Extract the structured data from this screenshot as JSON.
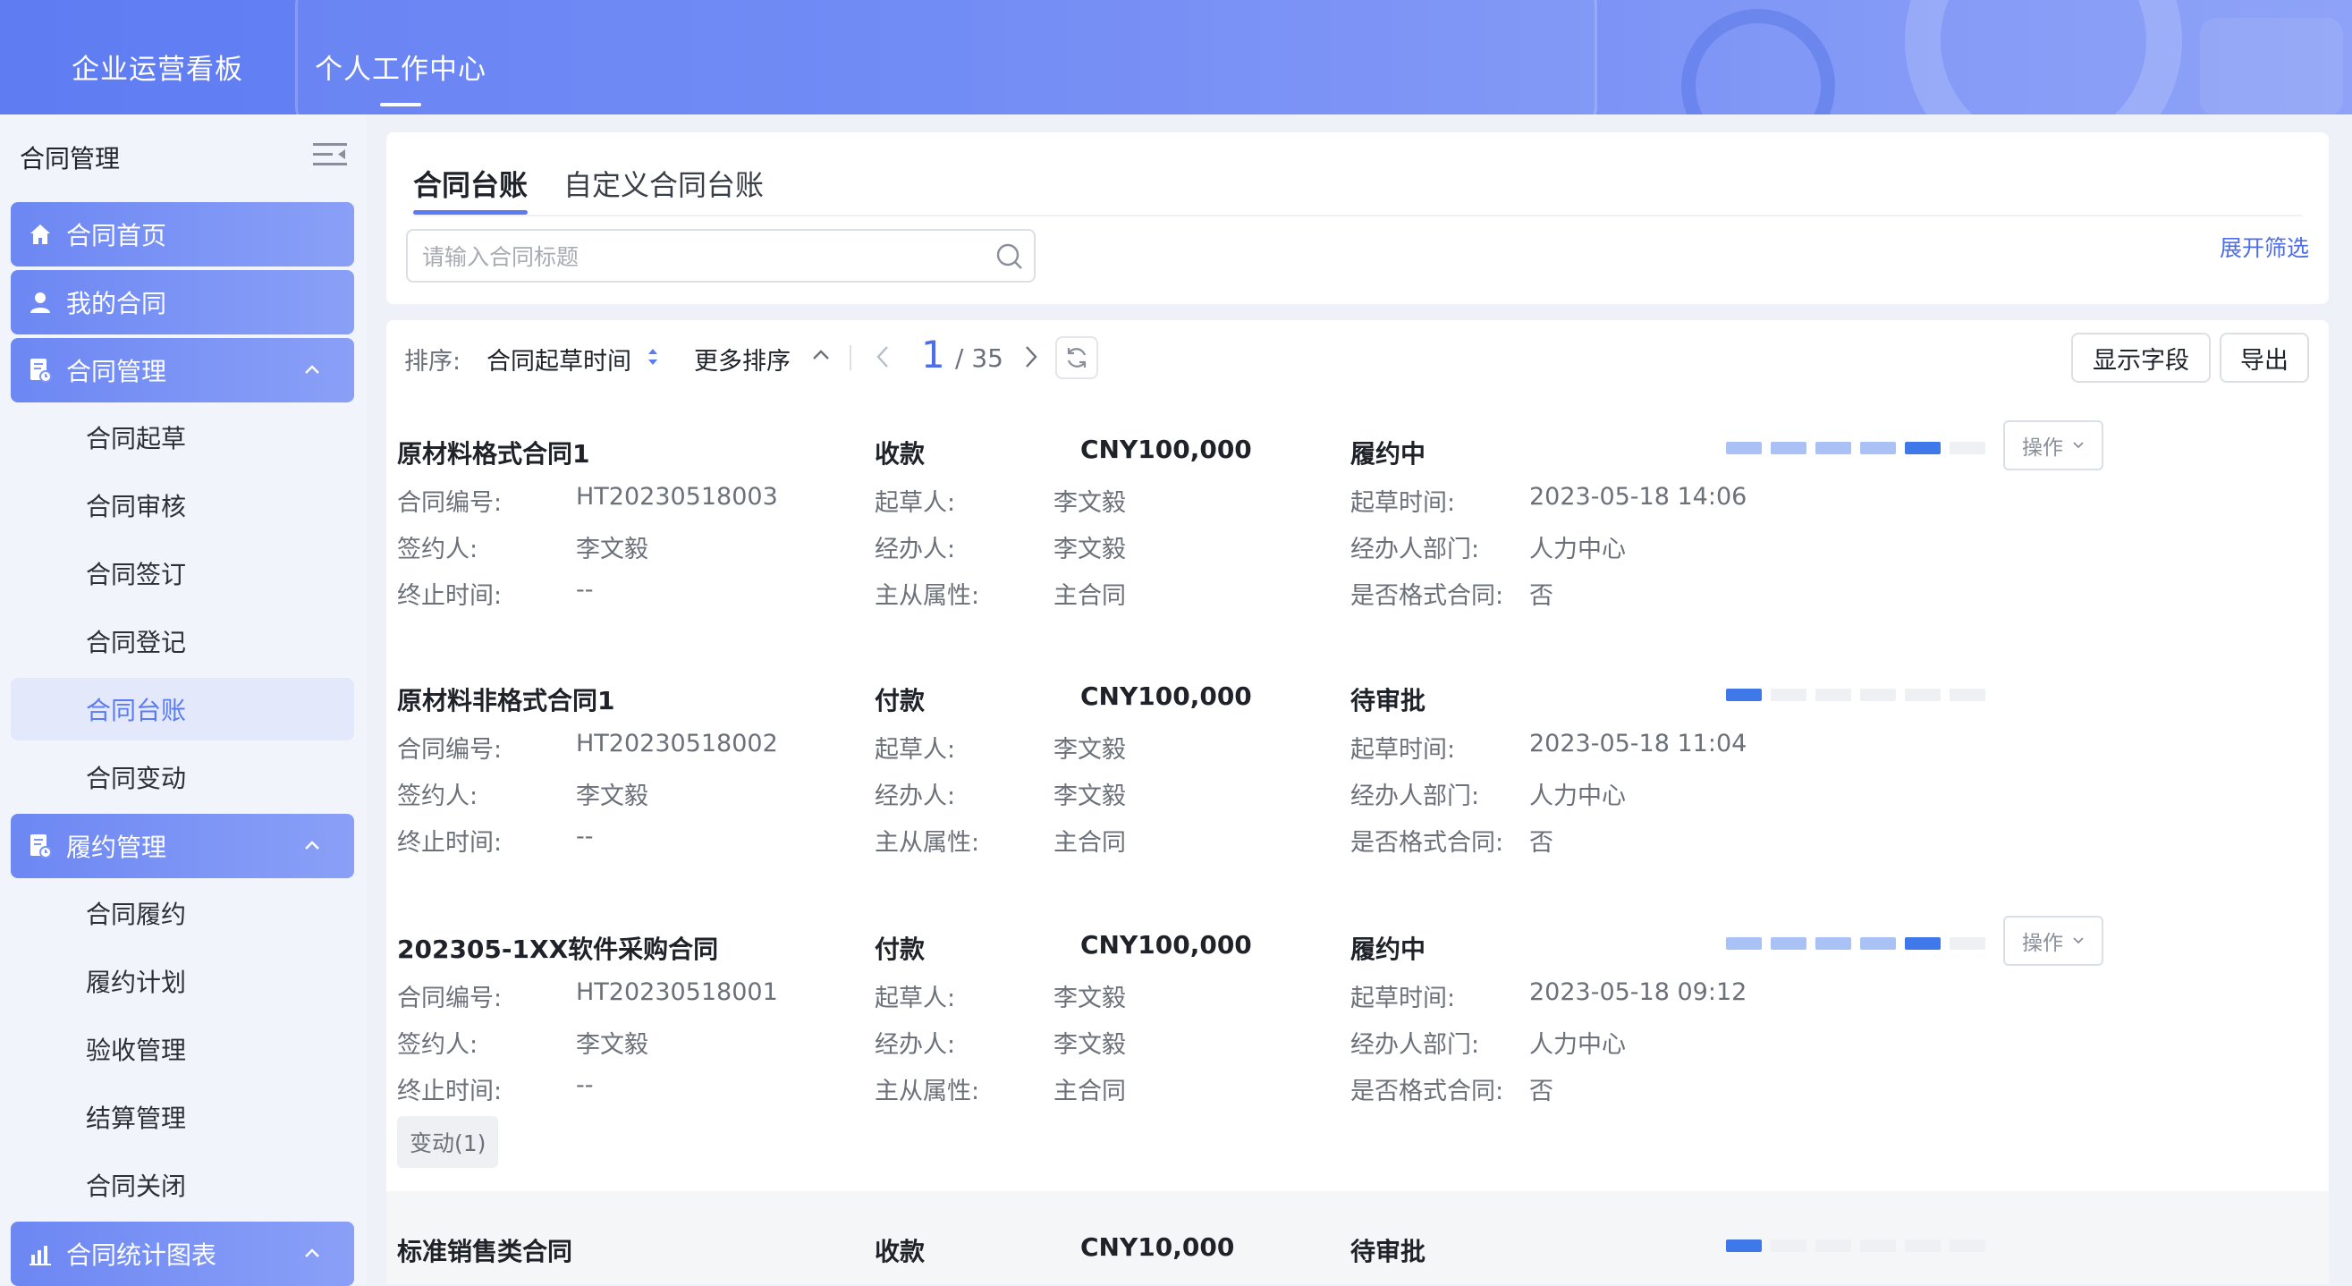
{
  "topnav": {
    "items": [
      "企业运营看板",
      "个人工作中心"
    ],
    "active": 1
  },
  "sidebar": {
    "header": "合同管理",
    "groups": [
      {
        "label": "合同首页",
        "icon": "home-icon"
      },
      {
        "label": "我的合同",
        "icon": "user-icon"
      },
      {
        "label": "合同管理",
        "icon": "contract-icon",
        "expanded": true,
        "children": [
          "合同起草",
          "合同审核",
          "合同签订",
          "合同登记",
          "合同台账",
          "合同变动"
        ],
        "active_child": 4
      },
      {
        "label": "履约管理",
        "icon": "contract-icon",
        "expanded": true,
        "children": [
          "合同履约",
          "履约计划",
          "验收管理",
          "结算管理",
          "合同关闭"
        ]
      },
      {
        "label": "合同统计图表",
        "icon": "chart-icon",
        "expanded": true
      }
    ]
  },
  "tabs": [
    {
      "label": "合同台账",
      "active": true
    },
    {
      "label": "自定义合同台账"
    }
  ],
  "search": {
    "placeholder": "请输入合同标题",
    "value": ""
  },
  "expand_filter": "展开筛选",
  "toolbar": {
    "sort_label": "排序:",
    "sort_field": "合同起草时间",
    "more_sort": "更多排序",
    "page_current": "1",
    "page_total": "/ 35",
    "show_fields": "显示字段",
    "export": "导出"
  },
  "labels": {
    "contract_no": "合同编号:",
    "signer": "签约人:",
    "end_time": "终止时间:",
    "drafter": "起草人:",
    "handler": "经办人:",
    "master_attr": "主从属性:",
    "draft_time": "起草时间:",
    "handler_dept": "经办人部门:",
    "is_format": "是否格式合同:",
    "operate": "操作"
  },
  "colors": {
    "accent": "#5b7cf0",
    "progress_done": "#a9c1f5",
    "progress_current": "#3f78e8",
    "progress_todo": "#eef0f3"
  },
  "rows": [
    {
      "title": "原材料格式合同1",
      "direction": "收款",
      "amount": "CNY100,000",
      "status": "履约中",
      "progress": [
        "done",
        "done",
        "done",
        "done",
        "current",
        "todo"
      ],
      "contract_no": "HT20230518003",
      "signer": "李文毅",
      "end_time": "--",
      "drafter": "李文毅",
      "handler": "李文毅",
      "master_attr": "主合同",
      "draft_time": "2023-05-18 14:06",
      "handler_dept": "人力中心",
      "is_format": "否",
      "has_operate": true
    },
    {
      "title": "原材料非格式合同1",
      "direction": "付款",
      "amount": "CNY100,000",
      "status": "待审批",
      "progress": [
        "current",
        "todo",
        "todo",
        "todo",
        "todo",
        "todo"
      ],
      "contract_no": "HT20230518002",
      "signer": "李文毅",
      "end_time": "--",
      "drafter": "李文毅",
      "handler": "李文毅",
      "master_attr": "主合同",
      "draft_time": "2023-05-18 11:04",
      "handler_dept": "人力中心",
      "is_format": "否",
      "has_operate": false
    },
    {
      "title": "202305-1XX软件采购合同",
      "direction": "付款",
      "amount": "CNY100,000",
      "status": "履约中",
      "progress": [
        "done",
        "done",
        "done",
        "done",
        "current",
        "todo"
      ],
      "contract_no": "HT20230518001",
      "signer": "李文毅",
      "end_time": "--",
      "drafter": "李文毅",
      "handler": "李文毅",
      "master_attr": "主合同",
      "draft_time": "2023-05-18 09:12",
      "handler_dept": "人力中心",
      "is_format": "否",
      "has_operate": true,
      "tag": "变动(1)"
    },
    {
      "title": "标准销售类合同",
      "direction": "收款",
      "amount": "CNY10,000",
      "status": "待审批",
      "progress": [
        "current",
        "todo",
        "todo",
        "todo",
        "todo",
        "todo"
      ],
      "has_operate": false
    }
  ]
}
